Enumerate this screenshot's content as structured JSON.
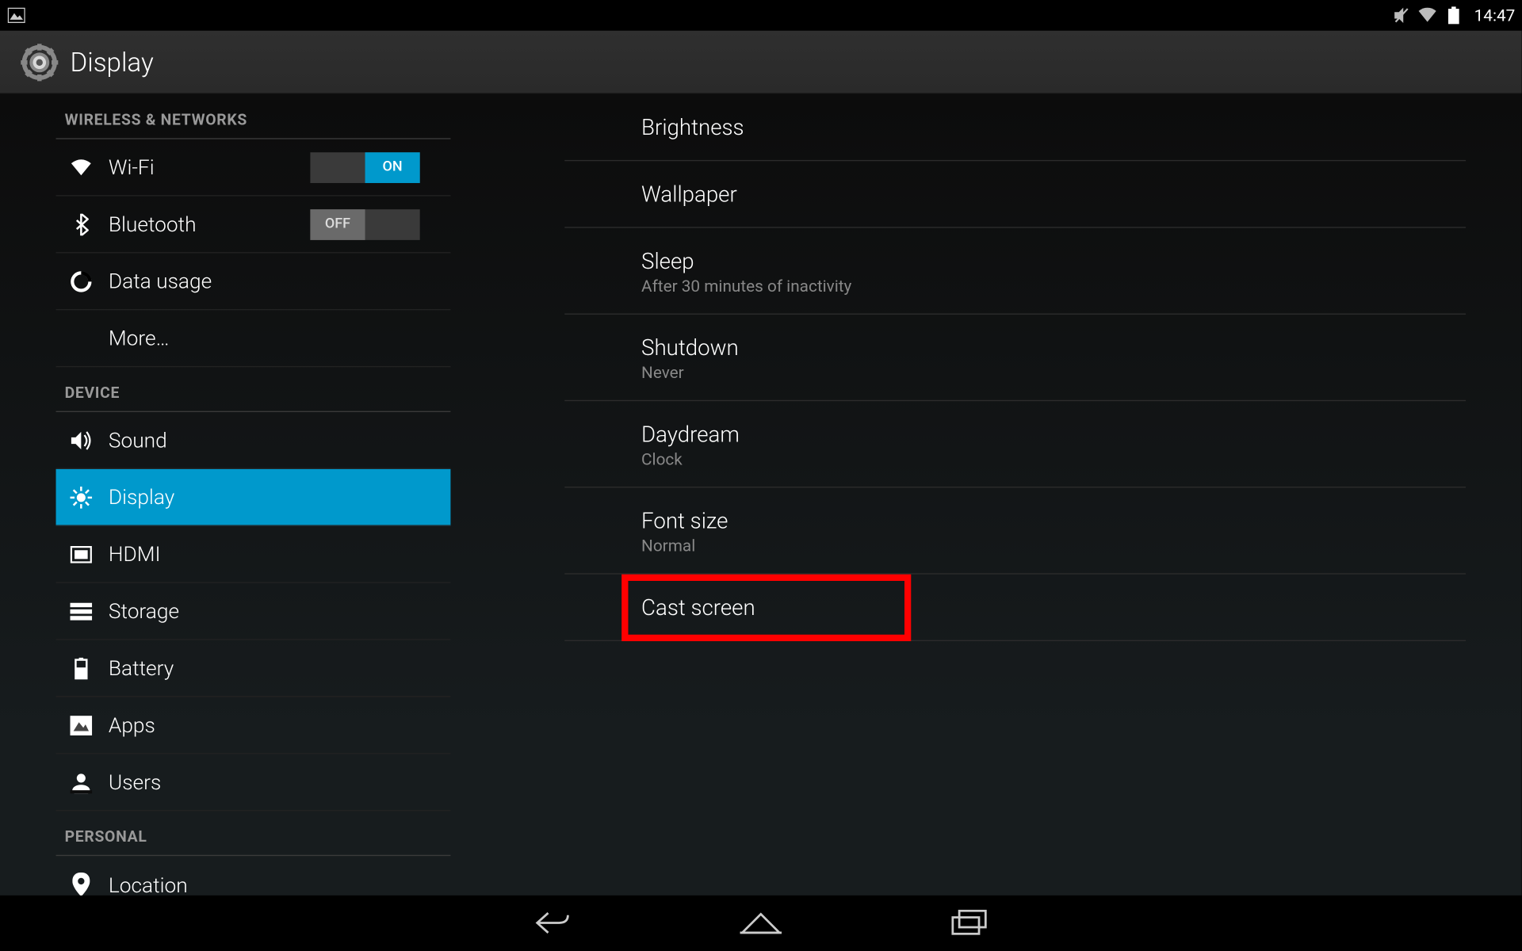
{
  "status": {
    "time": "14:47"
  },
  "action_bar": {
    "title": "Display"
  },
  "sidebar": {
    "sections": [
      {
        "header": "WIRELESS & NETWORKS",
        "items": [
          {
            "key": "wifi",
            "label": "Wi-Fi",
            "toggle": "ON"
          },
          {
            "key": "bluetooth",
            "label": "Bluetooth",
            "toggle": "OFF"
          },
          {
            "key": "data-usage",
            "label": "Data usage"
          },
          {
            "key": "more",
            "label": "More…"
          }
        ]
      },
      {
        "header": "DEVICE",
        "items": [
          {
            "key": "sound",
            "label": "Sound"
          },
          {
            "key": "display",
            "label": "Display",
            "active": true
          },
          {
            "key": "hdmi",
            "label": "HDMI"
          },
          {
            "key": "storage",
            "label": "Storage"
          },
          {
            "key": "battery",
            "label": "Battery"
          },
          {
            "key": "apps",
            "label": "Apps"
          },
          {
            "key": "users",
            "label": "Users"
          }
        ]
      },
      {
        "header": "PERSONAL",
        "items": [
          {
            "key": "location",
            "label": "Location"
          }
        ]
      }
    ]
  },
  "detail": {
    "items": [
      {
        "key": "brightness",
        "title": "Brightness"
      },
      {
        "key": "wallpaper",
        "title": "Wallpaper"
      },
      {
        "key": "sleep",
        "title": "Sleep",
        "summary": "After 30 minutes of inactivity"
      },
      {
        "key": "shutdown",
        "title": "Shutdown",
        "summary": "Never"
      },
      {
        "key": "daydream",
        "title": "Daydream",
        "summary": "Clock"
      },
      {
        "key": "font-size",
        "title": "Font size",
        "summary": "Normal"
      },
      {
        "key": "cast-screen",
        "title": "Cast screen",
        "highlight": true
      }
    ]
  },
  "toggle_labels": {
    "on": "ON",
    "off": "OFF"
  }
}
